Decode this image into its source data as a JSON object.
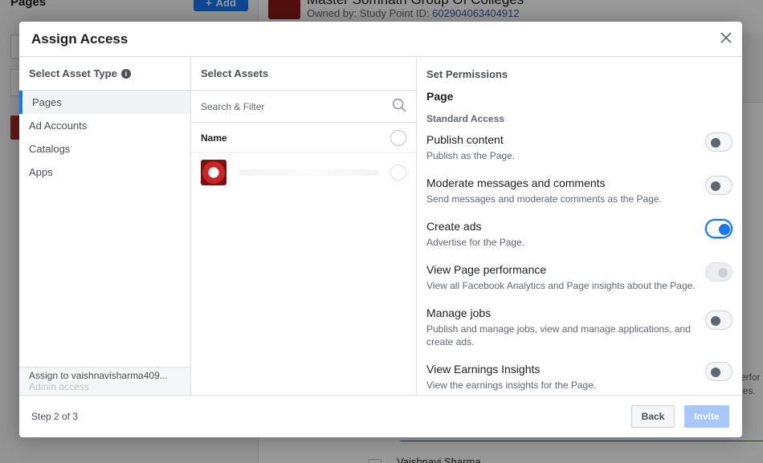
{
  "background": {
    "left_title": "Pages",
    "add_button": "Add",
    "header_title": "Master Somnath Group Of Colleges",
    "owner_label": "Owned by: Study Point  ID:",
    "owner_id": "602904063404912",
    "right_text_1": "erfor",
    "right_text_2": "les.",
    "bottom_name": "Vaishnavi Sharma"
  },
  "modal": {
    "title": "Assign Access",
    "asset_type": {
      "heading": "Select Asset Type",
      "items": [
        "Pages",
        "Ad Accounts",
        "Catalogs",
        "Apps"
      ],
      "selected": "Pages",
      "assign_to": "Assign to vaishnavisharma409...",
      "access_level": "Admin access"
    },
    "assets": {
      "heading": "Select Assets",
      "search_placeholder": "Search & Filter",
      "name_header": "Name"
    },
    "permissions": {
      "heading": "Set Permissions",
      "asset_label": "Page",
      "section": "Standard Access",
      "items": [
        {
          "title": "Publish content",
          "desc": "Publish as the Page.",
          "state": "off"
        },
        {
          "title": "Moderate messages and comments",
          "desc": "Send messages and moderate comments as the Page.",
          "state": "off"
        },
        {
          "title": "Create ads",
          "desc": "Advertise for the Page.",
          "state": "on"
        },
        {
          "title": "View Page performance",
          "desc": "View all Facebook Analytics and Page insights about the Page.",
          "state": "disabled"
        },
        {
          "title": "Manage jobs",
          "desc": "Publish and manage jobs, view and manage applications, and create ads.",
          "state": "off"
        },
        {
          "title": "View Earnings Insights",
          "desc": "View the earnings insights for the Page.",
          "state": "off"
        }
      ]
    },
    "footer": {
      "step": "Step 2 of 3",
      "back": "Back",
      "invite": "Invite"
    }
  },
  "colors": {
    "accent": "#1877f2",
    "invite_disabled": "#a8c7fa"
  }
}
